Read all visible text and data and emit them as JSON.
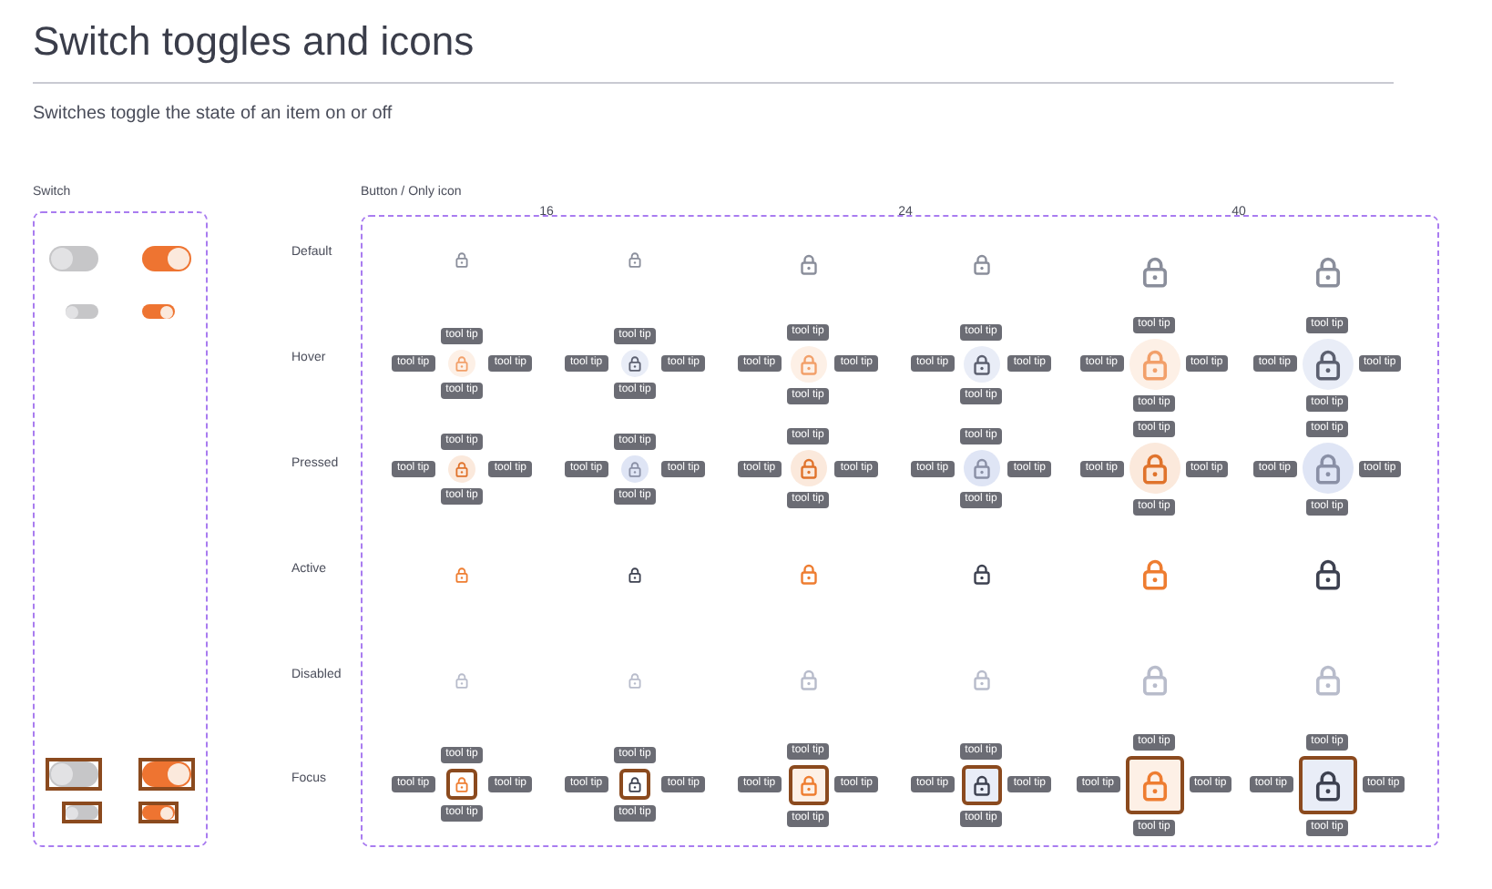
{
  "title": "Switch toggles and icons",
  "subtitle": "Switches toggle the state of an item on or off",
  "switch_panel": {
    "label": "Switch",
    "rows": [
      {
        "kind": "large",
        "switches": [
          {
            "checked": false,
            "focused": false
          },
          {
            "checked": true,
            "focused": false
          }
        ]
      },
      {
        "kind": "small",
        "switches": [
          {
            "checked": false,
            "focused": false
          },
          {
            "checked": true,
            "focused": false
          }
        ]
      },
      {
        "kind": "large",
        "switches": [
          {
            "checked": false,
            "focused": true
          },
          {
            "checked": true,
            "focused": true
          }
        ]
      },
      {
        "kind": "small",
        "switches": [
          {
            "checked": false,
            "focused": true
          },
          {
            "checked": true,
            "focused": true
          }
        ]
      }
    ]
  },
  "icon_panel": {
    "label": "Button / Only icon",
    "sizes": [
      {
        "label": "16",
        "kind": "small",
        "variants": [
          {
            "kind": "accent"
          },
          {
            "kind": "neutral"
          }
        ]
      },
      {
        "label": "24",
        "kind": "medium",
        "variants": [
          {
            "kind": "accent"
          },
          {
            "kind": "neutral"
          }
        ]
      },
      {
        "label": "40",
        "kind": "large",
        "variants": [
          {
            "kind": "accent"
          },
          {
            "kind": "neutral"
          }
        ]
      }
    ],
    "rows": [
      {
        "label": "Default",
        "kind": "default"
      },
      {
        "label": "Hover",
        "kind": "hover",
        "cells": [
          {
            "tooltips": [
              "tool tip",
              "tool tip",
              "tool tip",
              "tool tip"
            ]
          },
          {
            "tooltips": [
              "tool tip",
              "tool tip",
              "tool tip",
              "tool tip"
            ]
          },
          {
            "tooltips": [
              "tool tip",
              "tool tip",
              "tool tip",
              "tool tip"
            ]
          },
          {
            "tooltips": [
              "tool tip",
              "tool tip",
              "tool tip",
              "tool tip"
            ]
          },
          {
            "tooltips": [
              "tool tip",
              "tool tip",
              "tool tip",
              "tool tip"
            ]
          },
          {
            "tooltips": [
              "tool tip",
              "tool tip",
              "tool tip",
              "tool tip"
            ]
          }
        ]
      },
      {
        "label": "Pressed",
        "kind": "pressed",
        "cells": [
          {
            "tooltips": [
              "tool tip",
              "tool tip",
              "tool tip",
              "tool tip"
            ]
          },
          {
            "tooltips": [
              "tool tip",
              "tool tip",
              "tool tip",
              "tool tip"
            ]
          },
          {
            "tooltips": [
              "tool tip",
              "tool tip",
              "tool tip",
              "tool tip"
            ]
          },
          {
            "tooltips": [
              "tool tip",
              "tool tip",
              "tool tip",
              "tool tip"
            ]
          },
          {
            "tooltips": [
              "tool tip",
              "tool tip",
              "tool tip",
              "tool tip"
            ]
          },
          {
            "tooltips": [
              "tool tip",
              "tool tip",
              "tool tip",
              "tool tip"
            ]
          }
        ]
      },
      {
        "label": "Active",
        "kind": "active"
      },
      {
        "label": "Disabled",
        "kind": "disabled"
      },
      {
        "label": "Focus",
        "kind": "focus",
        "cells": [
          {
            "tooltips": [
              "tool tip",
              "tool tip",
              "tool tip",
              "tool tip"
            ]
          },
          {
            "tooltips": [
              "tool tip",
              "tool tip",
              "tool tip",
              "tool tip"
            ]
          },
          {
            "tooltips": [
              "tool tip",
              "tool tip",
              "tool tip",
              "tool tip"
            ]
          },
          {
            "tooltips": [
              "tool tip",
              "tool tip",
              "tool tip",
              "tool tip"
            ]
          },
          {
            "tooltips": [
              "tool tip",
              "tool tip",
              "tool tip",
              "tool tip"
            ]
          },
          {
            "tooltips": [
              "tool tip",
              "tool tip",
              "tool tip",
              "tool tip"
            ]
          }
        ]
      }
    ]
  }
}
